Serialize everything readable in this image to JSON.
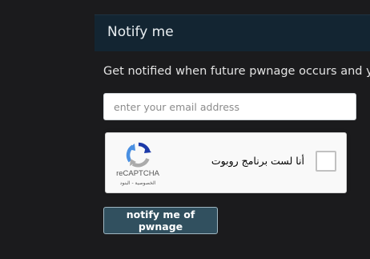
{
  "header": {
    "title": "Notify me"
  },
  "intro": {
    "text": "Get notified when future pwnage occurs and you"
  },
  "form": {
    "email_placeholder": "enter your email address",
    "email_value": "",
    "submit_label": "notify me of pwnage"
  },
  "recaptcha": {
    "label": "أنا لست برنامج روبوت",
    "brand": "reCAPTCHA",
    "links": "الخصوصية - البنود",
    "checked": false
  },
  "colors": {
    "background": "#1b1b1d",
    "header_bar": "#132532",
    "button": "#31505f",
    "recaptcha_blue": "#1c3aa9",
    "recaptcha_lightblue": "#4a90e2",
    "recaptcha_gray": "#ababab"
  },
  "icons": {
    "recaptcha_logo": "recaptcha-logo-icon"
  }
}
